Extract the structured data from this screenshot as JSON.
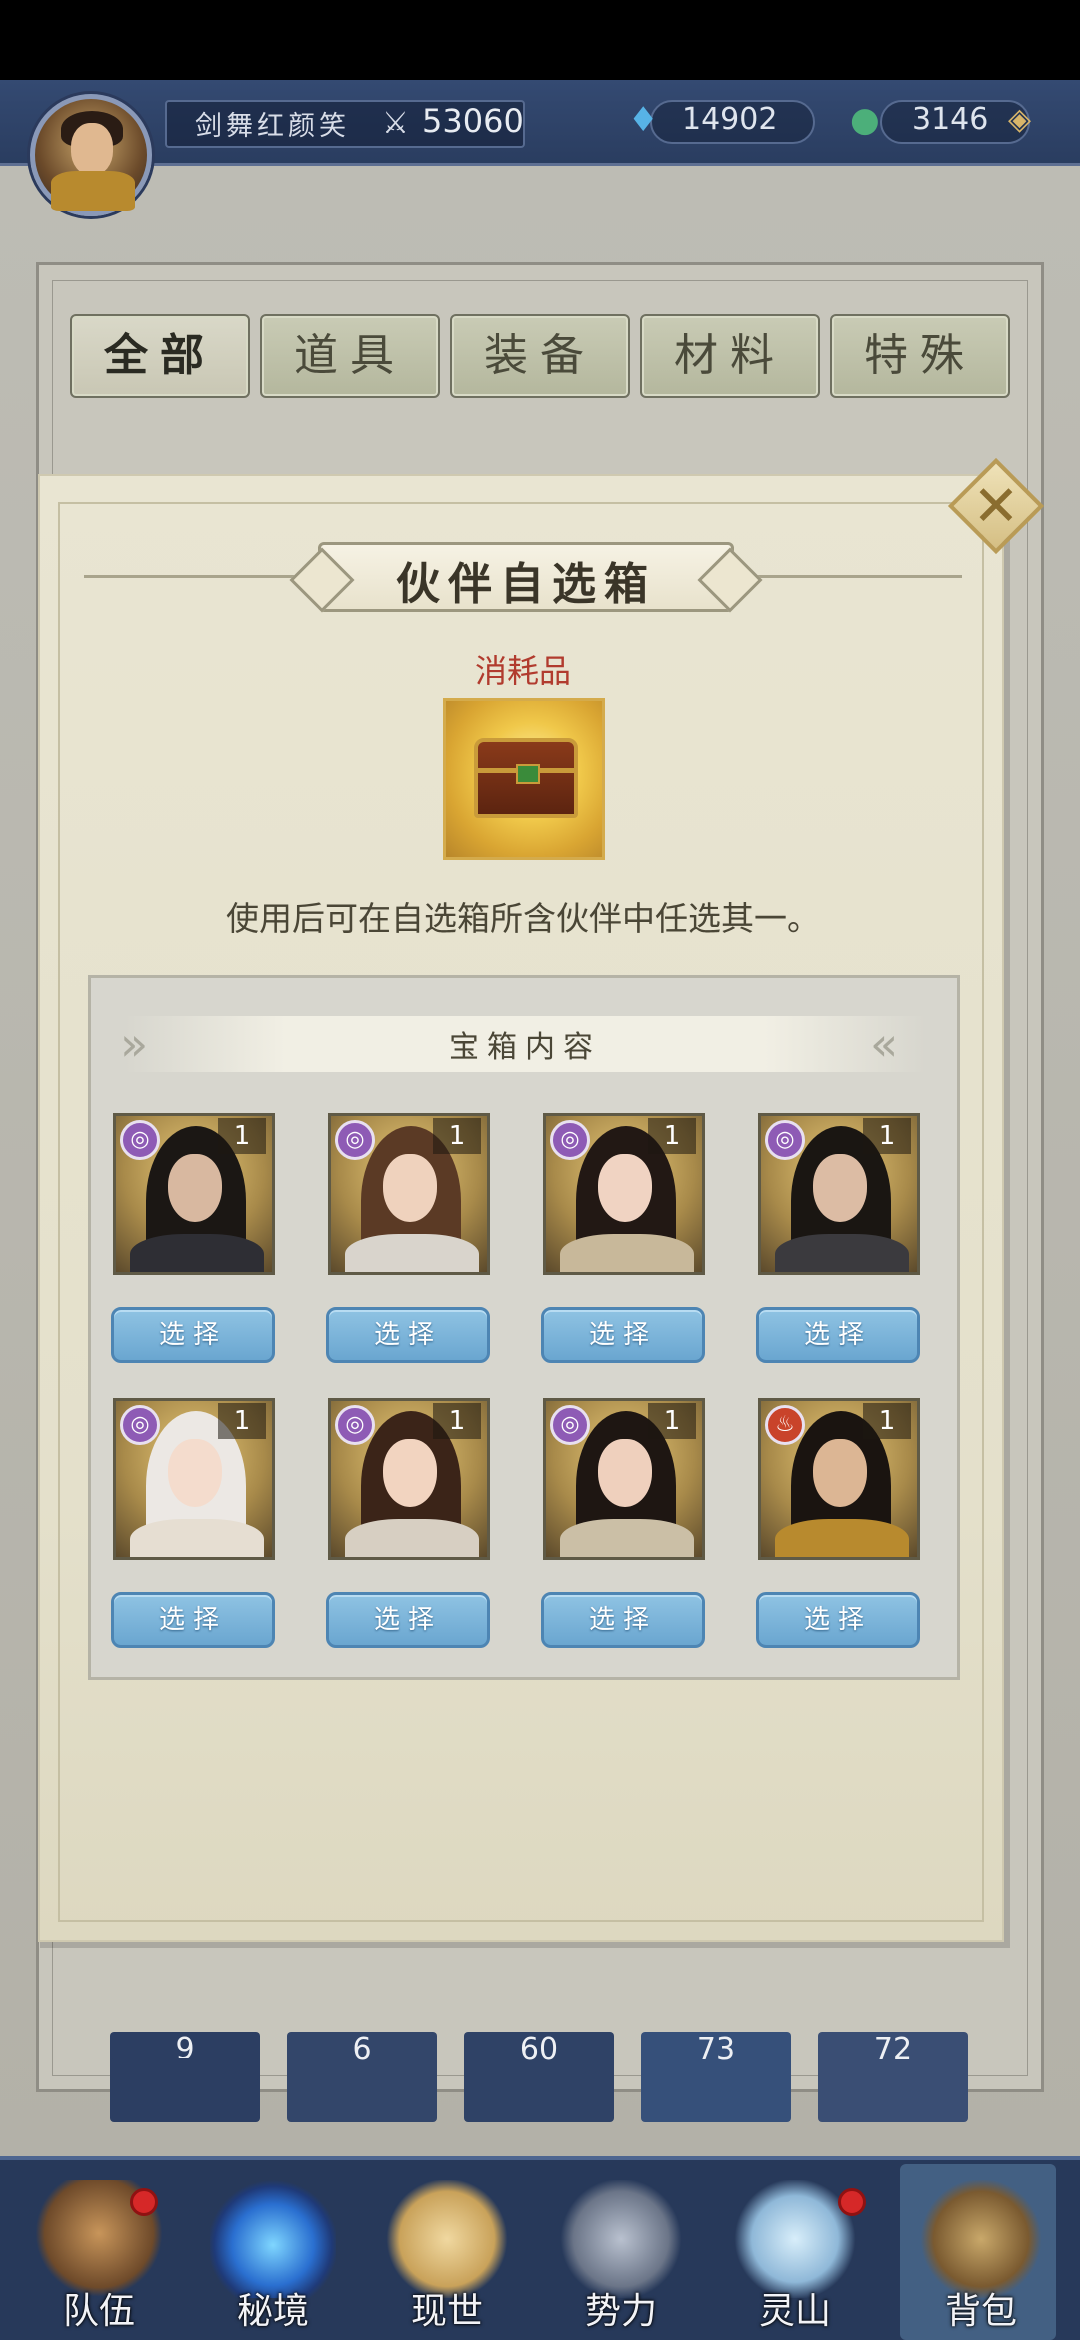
{
  "header": {
    "player_name": "剑舞红颜笑",
    "power": "53060",
    "currency_crystal": "14902",
    "currency_jade": "3146"
  },
  "inventory": {
    "tabs": [
      "全部",
      "道具",
      "装备",
      "材料",
      "特殊"
    ],
    "visible_counts": [
      "9",
      "6",
      "60",
      "73",
      "72"
    ]
  },
  "modal": {
    "title": "伙伴自选箱",
    "category": "消耗品",
    "description": "使用后可在自选箱所含伙伴中任选其一。",
    "contents_title": "宝箱内容",
    "select_label": "选择",
    "partners": [
      {
        "count": "1",
        "element": "water",
        "badge_color": "#8e5bb5"
      },
      {
        "count": "1",
        "element": "water",
        "badge_color": "#8e5bb5"
      },
      {
        "count": "1",
        "element": "water",
        "badge_color": "#8e5bb5"
      },
      {
        "count": "1",
        "element": "water",
        "badge_color": "#8e5bb5"
      },
      {
        "count": "1",
        "element": "water",
        "badge_color": "#8e5bb5"
      },
      {
        "count": "1",
        "element": "water",
        "badge_color": "#8e5bb5"
      },
      {
        "count": "1",
        "element": "water",
        "badge_color": "#8e5bb5"
      },
      {
        "count": "1",
        "element": "fire",
        "badge_color": "#c9432a"
      }
    ]
  },
  "bottom_nav": {
    "items": [
      "队伍",
      "秘境",
      "现世",
      "势力",
      "灵山",
      "背包"
    ]
  },
  "colors": {
    "accent_red": "#b13b2e",
    "select_button": "#6aa6d0",
    "nav_bar": "#27395a"
  }
}
